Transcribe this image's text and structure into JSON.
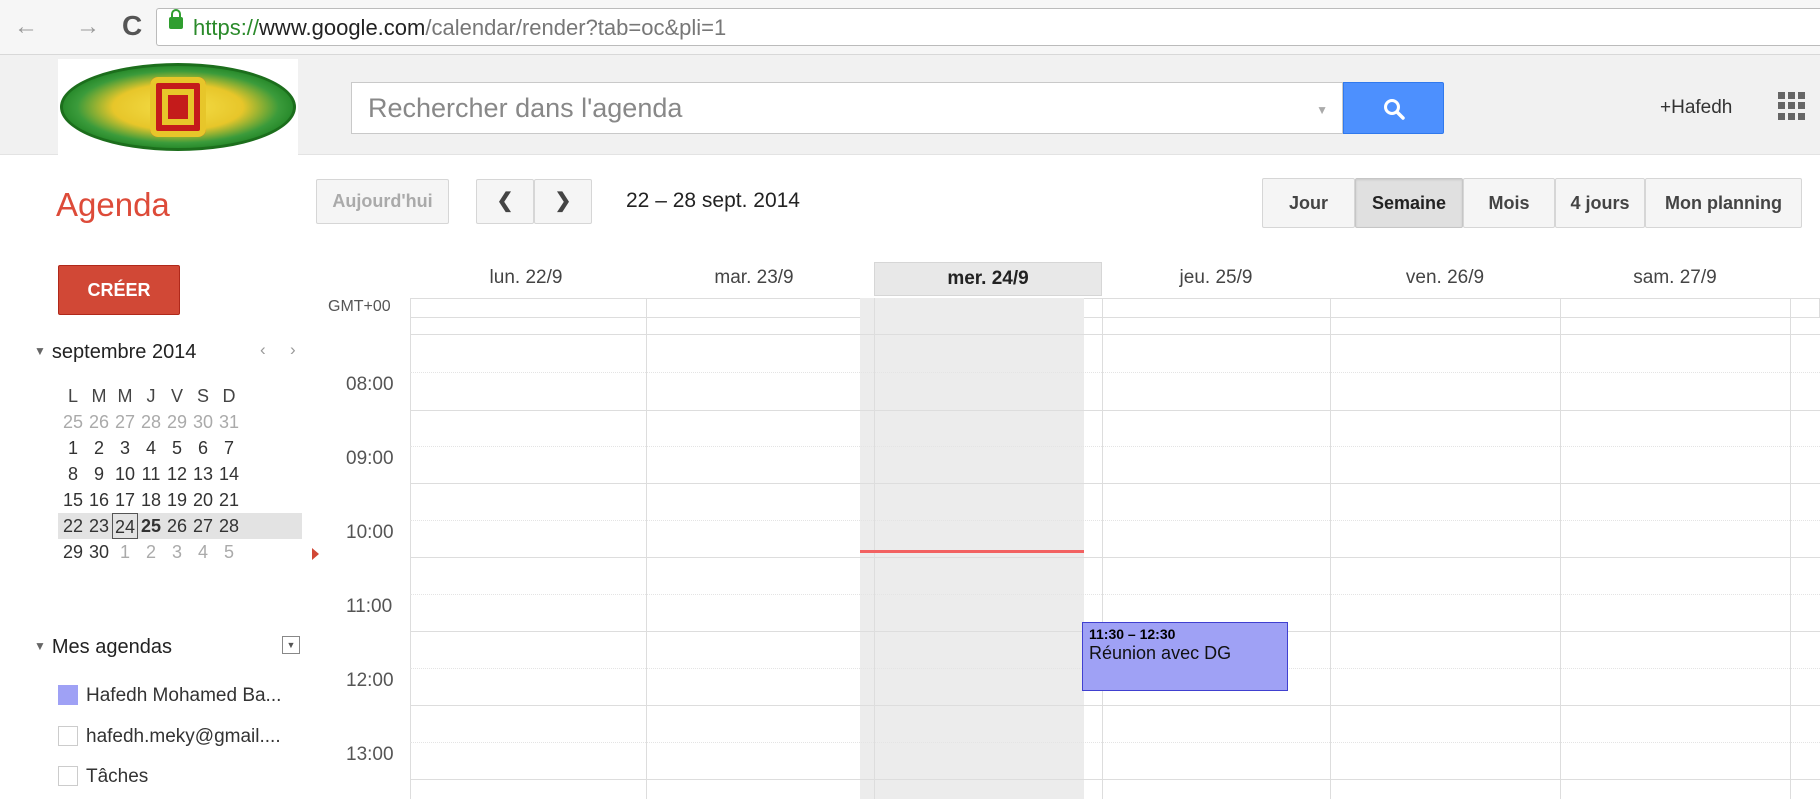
{
  "browser": {
    "url_scheme": "https://",
    "url_host": "www.google.com",
    "url_path": "/calendar/render?tab=oc&pli=1",
    "back_icon": "arrow-left-icon",
    "forward_icon": "arrow-right-icon",
    "reload_glyph": "C"
  },
  "header": {
    "search_placeholder": "Rechercher dans l'agenda",
    "user": "+Hafedh",
    "apps_icon": "apps-grid-icon"
  },
  "toolbar": {
    "brand": "Agenda",
    "today": "Aujourd'hui",
    "prev": "❮",
    "next": "❯",
    "date_range": "22 – 28 sept. 2014",
    "views": [
      "Jour",
      "Semaine",
      "Mois",
      "4 jours",
      "Mon planning"
    ],
    "active_view": "Semaine"
  },
  "sidebar": {
    "create": "CRÉER",
    "month_label": "septembre 2014",
    "month_prev": "‹",
    "month_next": "›",
    "weekday_heads": [
      "L",
      "M",
      "M",
      "J",
      "V",
      "S",
      "D"
    ],
    "weeks": [
      [
        "25",
        "26",
        "27",
        "28",
        "29",
        "30",
        "31"
      ],
      [
        "1",
        "2",
        "3",
        "4",
        "5",
        "6",
        "7"
      ],
      [
        "8",
        "9",
        "10",
        "11",
        "12",
        "13",
        "14"
      ],
      [
        "15",
        "16",
        "17",
        "18",
        "19",
        "20",
        "21"
      ],
      [
        "22",
        "23",
        "24",
        "25",
        "26",
        "27",
        "28"
      ],
      [
        "29",
        "30",
        "1",
        "2",
        "3",
        "4",
        "5"
      ]
    ],
    "my_calendars_label": "Mes agendas",
    "calendars": [
      {
        "label": "Hafedh Mohamed Ba...",
        "color": "#9fa1f5",
        "checked": true
      },
      {
        "label": "hafedh.meky@gmail....",
        "color": "#ffffff",
        "checked": false
      },
      {
        "label": "Tâches",
        "color": "#ffffff",
        "checked": false
      }
    ]
  },
  "grid": {
    "timezone": "GMT+00",
    "days": [
      "lun. 22/9",
      "mar. 23/9",
      "mer. 24/9",
      "jeu. 25/9",
      "ven. 26/9",
      "sam. 27/9"
    ],
    "today_index": 2,
    "hours": [
      "08:00",
      "09:00",
      "10:00",
      "11:00",
      "12:00",
      "13:00"
    ],
    "now_indicator_color": "#f26161"
  },
  "event": {
    "time": "11:30 – 12:30",
    "title": "Réunion avec DG",
    "color": "#9fa1f5",
    "day": "jeu. 25/9"
  },
  "colors": {
    "accent_red": "#dd4b39",
    "create_button": "#d14836",
    "search_blue": "#4d90fe"
  }
}
